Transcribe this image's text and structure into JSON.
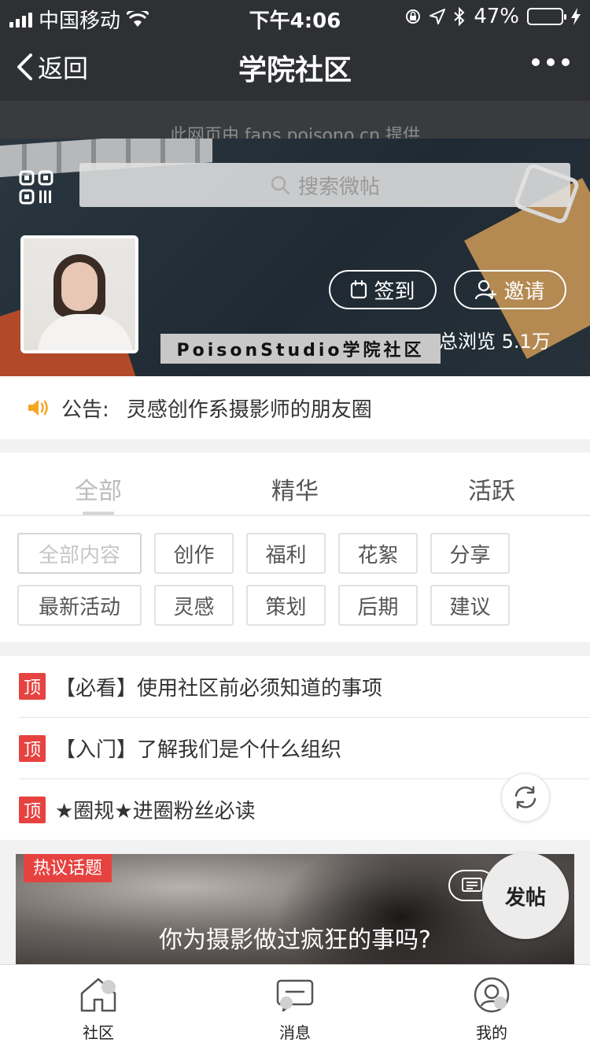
{
  "status_bar": {
    "carrier": "中国移动",
    "time": "下午4:06",
    "battery": "47%",
    "battery_level": 0.47,
    "icons": [
      "signal-icon",
      "wifi-icon",
      "lock-rotation-icon",
      "location-icon",
      "bluetooth-icon",
      "battery-icon",
      "charging-icon"
    ]
  },
  "nav": {
    "back_label": "返回",
    "title": "学院社区"
  },
  "provider_text": "此网页由 fans.poisono.cn 提供",
  "hero": {
    "search_placeholder": "搜索微帖",
    "checkin_label": "签到",
    "invite_label": "邀请",
    "community_name": "PoisonStudio学院社区",
    "views": "总浏览 5.1万"
  },
  "announcement": {
    "label": "公告:",
    "text": "灵感创作系摄影师的朋友圈"
  },
  "tabs": [
    {
      "label": "全部"
    },
    {
      "label": "精华"
    },
    {
      "label": "活跃"
    }
  ],
  "categories": [
    {
      "label": "全部内容"
    },
    {
      "label": "创作"
    },
    {
      "label": "福利"
    },
    {
      "label": "花絮"
    },
    {
      "label": "分享"
    },
    {
      "label": "最新活动"
    },
    {
      "label": "灵感"
    },
    {
      "label": "策划"
    },
    {
      "label": "后期"
    },
    {
      "label": "建议"
    }
  ],
  "pinned": {
    "badge": "顶",
    "posts": [
      {
        "title": "【必看】使用社区前必须知道的事项"
      },
      {
        "title": "【入门】了解我们是个什么组织"
      },
      {
        "title": "★圈规★进圈粉丝必读"
      }
    ]
  },
  "hot_topic": {
    "tag": "热议话题",
    "title": "你为摄影做过疯狂的事吗?"
  },
  "fab_label": "发帖",
  "tabbar": [
    {
      "label": "社区",
      "icon": "community-icon"
    },
    {
      "label": "消息",
      "icon": "message-icon"
    },
    {
      "label": "我的",
      "icon": "profile-icon"
    }
  ],
  "colors": {
    "nav_bg": "#2e3034",
    "pin_badge": "#e64340",
    "battery": "#4cd964",
    "speaker": "#f5a623"
  }
}
